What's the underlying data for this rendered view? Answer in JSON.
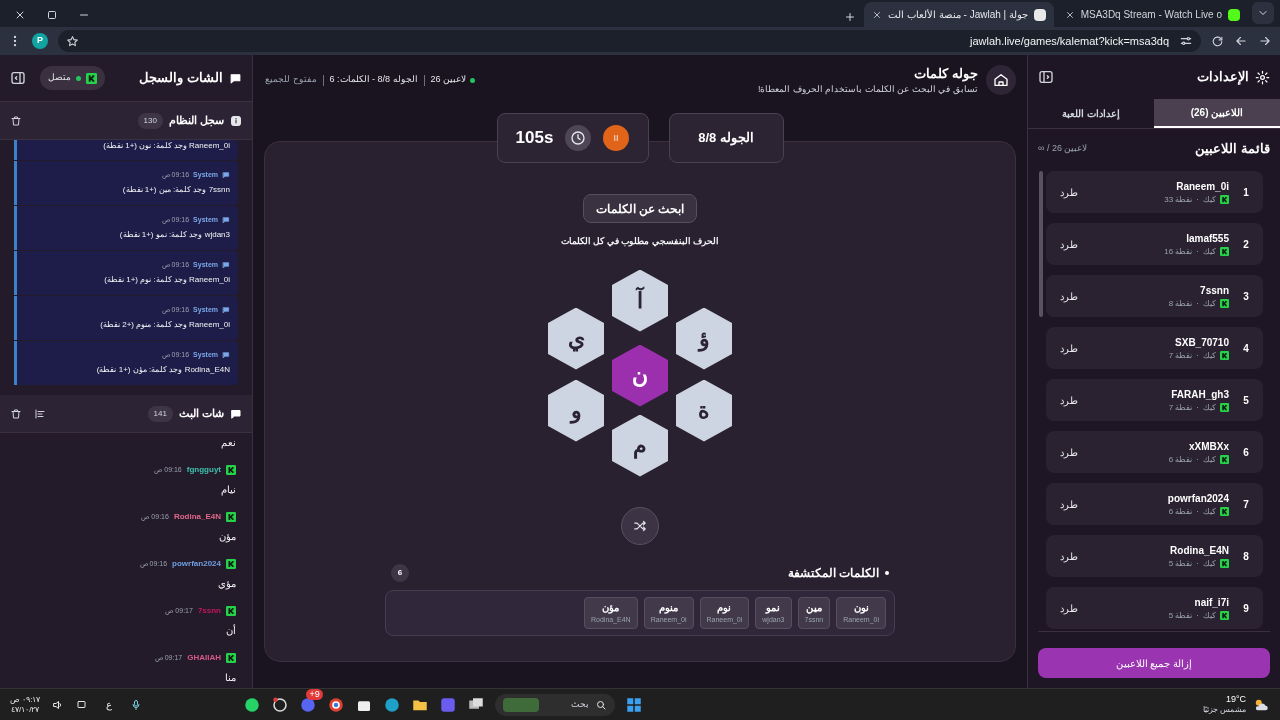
{
  "browser": {
    "tabs": [
      {
        "title": "MSA3Dq Stream - Watch Live o",
        "selected": false
      },
      {
        "title": "جولة | Jawlah - منصة الألعاب الت",
        "selected": true
      }
    ],
    "profile": "P",
    "url": "jawlah.live/games/kalemat?kick=msa3dq"
  },
  "settings": {
    "title": "الإعدادات",
    "tabs": [
      {
        "label": "اللاعبين (26)",
        "selected": true
      },
      {
        "label": "إعدادات اللعبة",
        "selected": false
      }
    ],
    "list_title": "قائمة اللاعبين",
    "capacity": "∞ / 26 لاعبين",
    "players": [
      {
        "rank": "1",
        "name": "Raneem_0i",
        "platform": "كيك",
        "separator": "·",
        "points": "33 نقطة",
        "action": "طرد"
      },
      {
        "rank": "2",
        "name": "lamaf555",
        "platform": "كيك",
        "separator": "·",
        "points": "16 نقطة",
        "action": "طرد"
      },
      {
        "rank": "3",
        "name": "7ssnn",
        "platform": "كيك",
        "separator": "·",
        "points": "8 نقطة",
        "action": "طرد"
      },
      {
        "rank": "4",
        "name": "SXB_70710",
        "platform": "كيك",
        "separator": "·",
        "points": "7 نقطة",
        "action": "طرد"
      },
      {
        "rank": "5",
        "name": "FARAH_gh3",
        "platform": "كيك",
        "separator": "·",
        "points": "7 نقطة",
        "action": "طرد"
      },
      {
        "rank": "6",
        "name": "xXMBXx",
        "platform": "كيك",
        "separator": "·",
        "points": "6 نقطة",
        "action": "طرد"
      },
      {
        "rank": "7",
        "name": "powrfan2024",
        "platform": "كيك",
        "separator": "·",
        "points": "6 نقطة",
        "action": "طرد"
      },
      {
        "rank": "8",
        "name": "Rodina_E4N",
        "platform": "كيك",
        "separator": "·",
        "points": "5 نقطة",
        "action": "طرد"
      },
      {
        "rank": "9",
        "name": "naif_i7i",
        "platform": "كيك",
        "separator": "·",
        "points": "5 نقطة",
        "action": "طرد"
      }
    ],
    "remove_all": "إزالة جميع اللاعبين"
  },
  "game": {
    "title": "جوله كلمات",
    "subtitle": "تسابق في البحث عن الكلمات باستخدام الحروف المعطاة!",
    "stats": [
      "26 لاعبين",
      "الجوله 8/8 - الكلمات: 6",
      "مفتوح للجميع"
    ],
    "round": "الجوله 8/8",
    "timer": "105s",
    "search_button": "ابحث عن الكلمات",
    "hint": "الحرف البنفسجي مطلوب في كل الكلمات",
    "letters": [
      {
        "letter": "آ",
        "required": false
      },
      {
        "letter": "ؤ",
        "required": false
      },
      {
        "letter": "ة",
        "required": false
      },
      {
        "letter": "م",
        "required": false
      },
      {
        "letter": "و",
        "required": false
      },
      {
        "letter": "ي",
        "required": false
      },
      {
        "letter": "ن",
        "required": true
      }
    ],
    "found_words": {
      "title": "الكلمات المكتشفة",
      "count": "6",
      "words": [
        {
          "word": "نون",
          "player": "Raneem_0i"
        },
        {
          "word": "مين",
          "player": "7ssnn"
        },
        {
          "word": "نمو",
          "player": "wjdan3"
        },
        {
          "word": "نوم",
          "player": "Raneem_0i"
        },
        {
          "word": "منوم",
          "player": "Raneem_0i"
        },
        {
          "word": "مؤن",
          "player": "Rodina_E4N"
        }
      ]
    }
  },
  "chat_panel": {
    "title": "الشات والسجل",
    "connection": "متصل",
    "system_log": {
      "title": "سجل النظام",
      "count": "130",
      "entries": [
        {
          "text": "Raneem_0i وجد كلمة: نون (+1 نقطة)"
        },
        {
          "sender": "System",
          "time": "09:16 ص",
          "text": "7ssnn وجد كلمة: مين (+1 نقطة)"
        },
        {
          "sender": "System",
          "time": "09:16 ص",
          "text": "wjdan3 وجد كلمة: نمو (+1 نقطة)"
        },
        {
          "sender": "System",
          "time": "09:16 ص",
          "text": "Raneem_0i وجد كلمة: نوم (+1 نقطة)"
        },
        {
          "sender": "System",
          "time": "09:16 ص",
          "text": "Raneem_0i وجد كلمة: منوم (+2 نقطة)"
        },
        {
          "sender": "System",
          "time": "09:16 ص",
          "text": "Rodina_E4N وجد كلمة: مؤن (+1 نقطة)"
        }
      ]
    },
    "stream_chat": {
      "title": "شات البث",
      "count": "141",
      "messages": [
        {
          "text": "نعم"
        },
        {
          "user": "fgngguyt",
          "color": "#3fc1b0",
          "time": "09:16 ص",
          "text": "نيام"
        },
        {
          "user": "Rodina_E4N",
          "color": "#e0688a",
          "time": "09:16 ص",
          "text": "مؤن"
        },
        {
          "user": "powrfan2024",
          "color": "#6f9fe0",
          "time": "09:16 ص",
          "text": "مؤي"
        },
        {
          "user": "7ssnn",
          "color": "#c2185b",
          "time": "09:17 ص",
          "text": "أن"
        },
        {
          "user": "GHAIIAH",
          "color": "#d65a86",
          "time": "09:17 ص",
          "text": "منا"
        }
      ]
    }
  },
  "taskbar": {
    "weather": {
      "temp": "19°C",
      "condition": "مشمس جزئيًا"
    },
    "search_placeholder": "بحث",
    "discord_badge": "9+",
    "language": "ع",
    "time": "٠٩:١٧ ص",
    "date": "٤٧/١٠/٢٧"
  }
}
